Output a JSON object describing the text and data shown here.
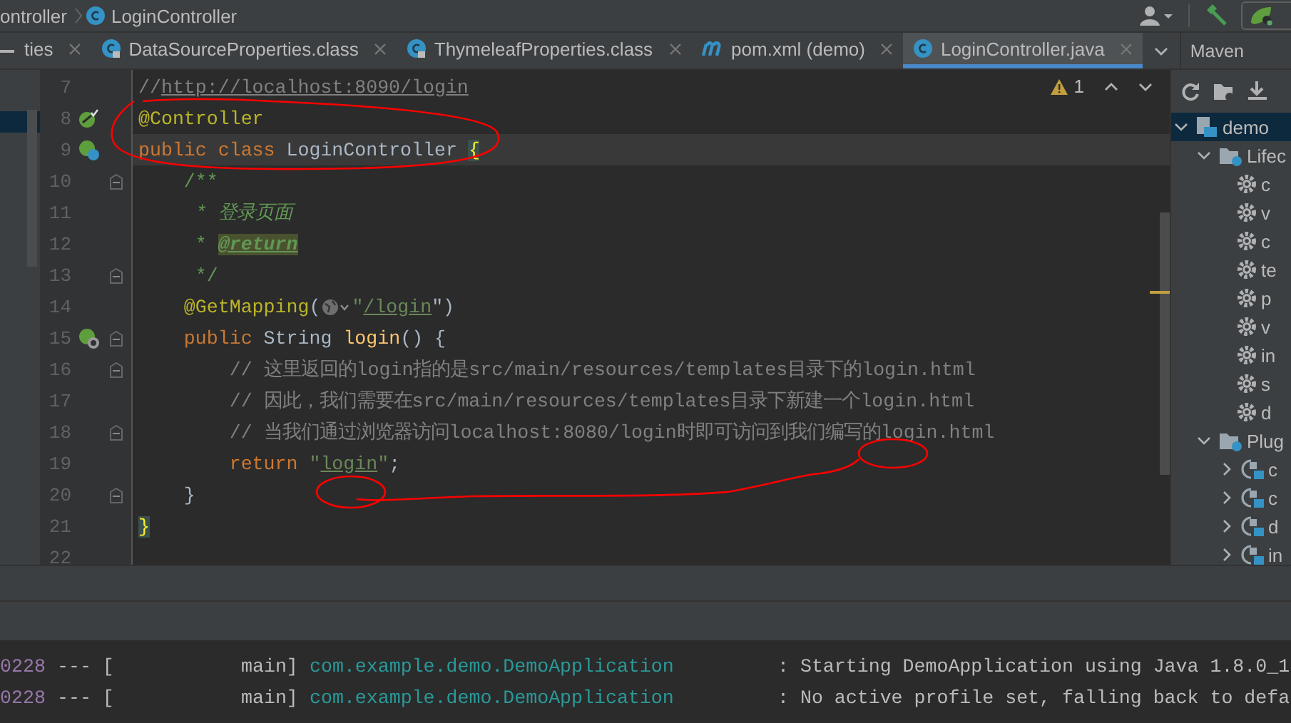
{
  "breadcrumb": [
    {
      "label": "ontroller",
      "kind": "package"
    },
    {
      "label": "LoginController",
      "kind": "class"
    }
  ],
  "tabs": [
    {
      "label": "ties",
      "kind": "plain",
      "selected": false
    },
    {
      "label": "DataSourceProperties.class",
      "kind": "class-locked",
      "selected": false
    },
    {
      "label": "ThymeleafProperties.class",
      "kind": "class-locked",
      "selected": false
    },
    {
      "label": "pom.xml (demo)",
      "kind": "maven",
      "selected": false
    },
    {
      "label": "LoginController.java",
      "kind": "class",
      "selected": true
    }
  ],
  "editor": {
    "warning_count": "1",
    "lines": [
      {
        "number": "7",
        "fold": false,
        "current": false,
        "tokens": [
          {
            "text": "//",
            "kind": "comment"
          },
          {
            "text": "http://localhost:8090/login",
            "kind": "comment-link"
          }
        ]
      },
      {
        "number": "8",
        "gutter": {
          "kind": "bean"
        },
        "fold": false,
        "current": false,
        "tokens": [
          {
            "text": "@Controller",
            "kind": "annotation"
          }
        ]
      },
      {
        "number": "9",
        "gutter": {
          "kind": "bean-class"
        },
        "fold": false,
        "current": true,
        "tokens": [
          {
            "text": "public class",
            "kind": "keyword"
          },
          {
            "text": "LoginController",
            "kind": "class"
          },
          {
            "text": "{",
            "kind": "brace"
          }
        ]
      },
      {
        "number": "10",
        "fold": true,
        "current": false,
        "tokens": [
          {
            "text": "    /**",
            "kind": "doc"
          }
        ]
      },
      {
        "number": "11",
        "fold": false,
        "current": false,
        "tokens": [
          {
            "text": "     * 登录页面",
            "kind": "doc-italic"
          }
        ]
      },
      {
        "number": "12",
        "fold": false,
        "current": false,
        "tokens": [
          {
            "text": "     *",
            "kind": "doc"
          },
          {
            "text": "@return",
            "kind": "doc-tag"
          }
        ]
      },
      {
        "number": "13",
        "fold": true,
        "current": false,
        "tokens": [
          {
            "text": "     */",
            "kind": "doc"
          }
        ]
      },
      {
        "number": "14",
        "fold": false,
        "current": false,
        "tokens": [
          {
            "text": "    @GetMapping",
            "kind": "annotation"
          },
          {
            "text": "(",
            "kind": "plain"
          },
          {
            "kind": "globe"
          },
          {
            "text": "\"",
            "kind": "string"
          },
          {
            "text": "/login",
            "kind": "string-link"
          },
          {
            "text": "\")",
            "kind": "plain"
          }
        ]
      },
      {
        "number": "15",
        "gutter": {
          "kind": "bean-method"
        },
        "fold": true,
        "current": false,
        "tokens": [
          {
            "text": "    public",
            "kind": "keyword"
          },
          {
            "text": "String",
            "kind": "class"
          },
          {
            "text": "login",
            "kind": "method"
          },
          {
            "text": "() {",
            "kind": "plain"
          }
        ]
      },
      {
        "number": "16",
        "fold": true,
        "current": false,
        "tokens": [
          {
            "text": "        // 这里返回的login指的是src/main/resources/templates目录下的login.html",
            "kind": "comment"
          }
        ]
      },
      {
        "number": "17",
        "fold": false,
        "current": false,
        "tokens": [
          {
            "text": "        // 因此，我们需要在src/main/resources/templates目录下新建一个login.html",
            "kind": "comment"
          }
        ]
      },
      {
        "number": "18",
        "fold": true,
        "current": false,
        "tokens": [
          {
            "text": "        // 当我们通过浏览器访问localhost:8080/login时即可访问到我们编写的login.html",
            "kind": "comment"
          }
        ]
      },
      {
        "number": "19",
        "fold": false,
        "current": false,
        "tokens": [
          {
            "text": "        return",
            "kind": "keyword"
          },
          {
            "text": "\"",
            "kind": "string"
          },
          {
            "text": "login",
            "kind": "string-link"
          },
          {
            "text": "\"",
            "kind": "string"
          },
          {
            "text": ";",
            "kind": "plain"
          }
        ]
      },
      {
        "number": "20",
        "fold": true,
        "current": false,
        "tokens": [
          {
            "text": "    }",
            "kind": "plain"
          }
        ]
      },
      {
        "number": "21",
        "fold": false,
        "current": false,
        "tokens": [
          {
            "text": "}",
            "kind": "brace"
          }
        ]
      },
      {
        "number": "22",
        "fold": false,
        "current": false
      }
    ]
  },
  "maven": {
    "title": "Maven",
    "tree": [
      {
        "label": "demo",
        "kind": "project",
        "selected": true,
        "expanded": true,
        "children": [
          {
            "label": "Lifec",
            "kind": "folder",
            "selected": false,
            "expanded": true,
            "children": [
              {
                "label": "c",
                "kind": "goal",
                "selected": false
              },
              {
                "label": "v",
                "kind": "goal",
                "selected": false
              },
              {
                "label": "c",
                "kind": "goal",
                "selected": false
              },
              {
                "label": "te",
                "kind": "goal",
                "selected": false
              },
              {
                "label": "p",
                "kind": "goal",
                "selected": false
              },
              {
                "label": "v",
                "kind": "goal",
                "selected": false
              },
              {
                "label": "in",
                "kind": "goal",
                "selected": false
              },
              {
                "label": "s",
                "kind": "goal",
                "selected": false
              },
              {
                "label": "d",
                "kind": "goal",
                "selected": false
              }
            ]
          },
          {
            "label": "Plug",
            "kind": "folder",
            "selected": false,
            "expanded": true,
            "children": [
              {
                "label": "c",
                "kind": "plugin",
                "selected": false,
                "expanded": false
              },
              {
                "label": "c",
                "kind": "plugin",
                "selected": false,
                "expanded": false
              },
              {
                "label": "d",
                "kind": "plugin",
                "selected": false,
                "expanded": false
              },
              {
                "label": "in",
                "kind": "plugin",
                "selected": false,
                "expanded": false
              }
            ]
          }
        ]
      }
    ]
  },
  "console": {
    "lines": [
      {
        "pid": "0228",
        "sep": "--- [",
        "thread": "main]",
        "logger": "com.example.demo.DemoApplication",
        "message": ": Starting DemoApplication using Java 1.8.0_1"
      },
      {
        "pid": "0228",
        "sep": "--- [",
        "thread": "main]",
        "logger": "com.example.demo.DemoApplication",
        "message": ": No active profile set, falling back to defa"
      }
    ]
  }
}
